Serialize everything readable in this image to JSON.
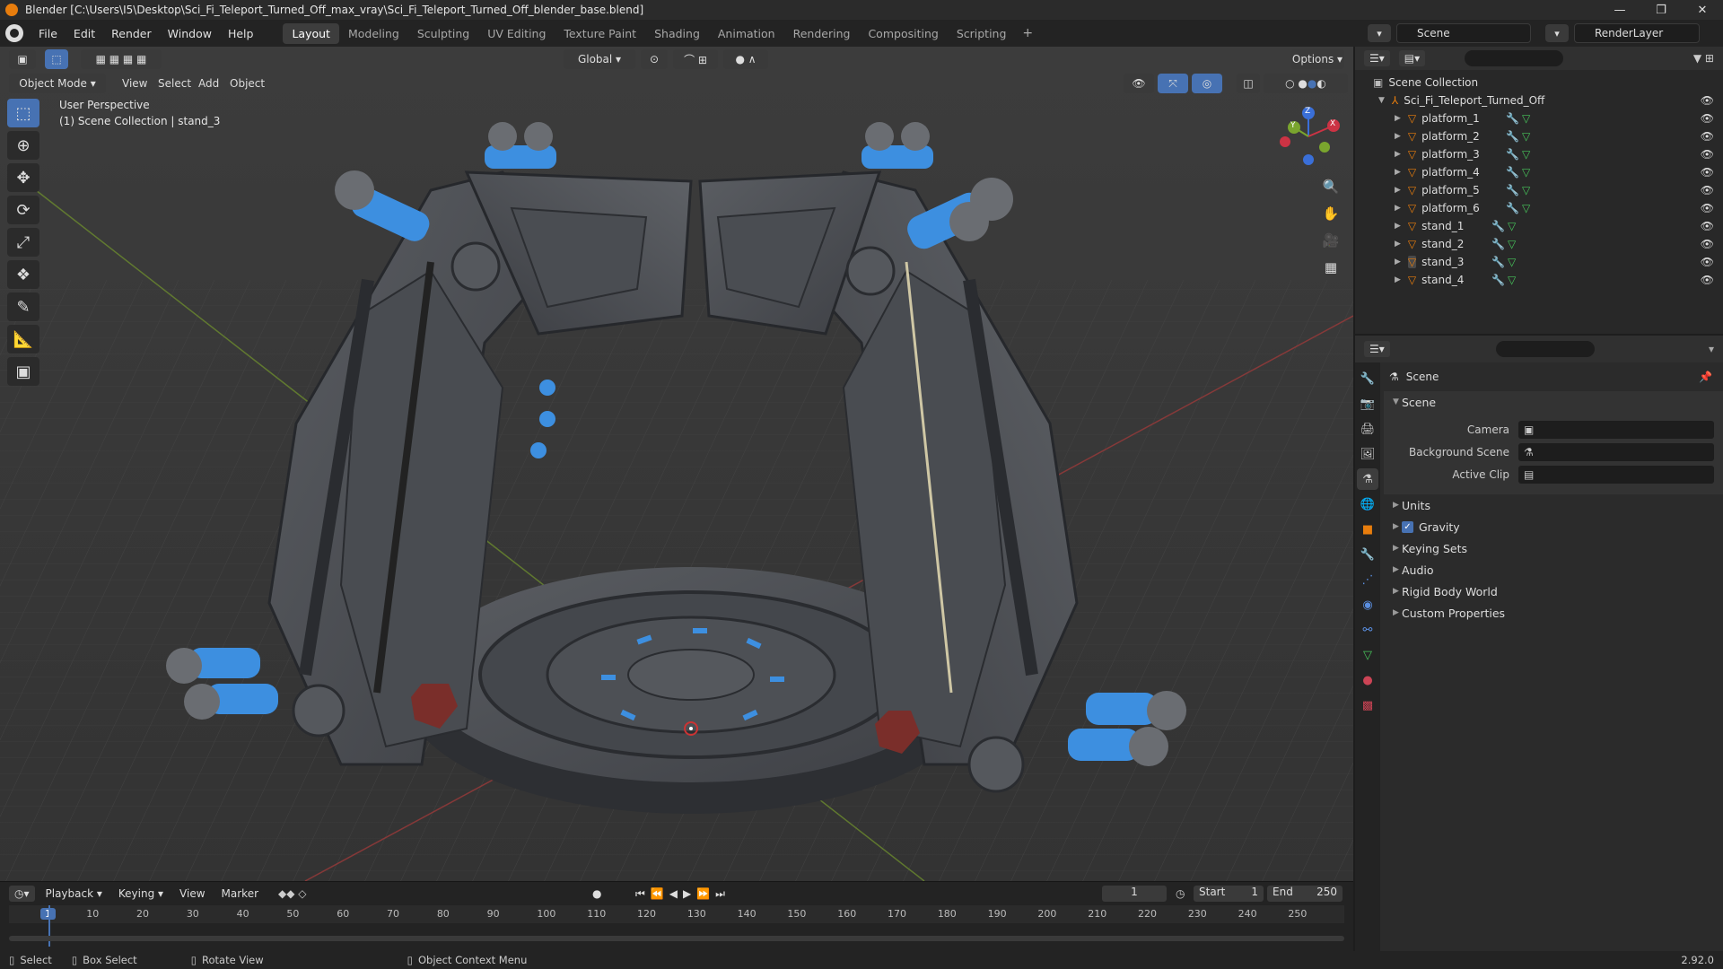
{
  "window": {
    "title": "Blender [C:\\Users\\I5\\Desktop\\Sci_Fi_Teleport_Turned_Off_max_vray\\Sci_Fi_Teleport_Turned_Off_blender_base.blend]",
    "minimize": "—",
    "maximize": "❐",
    "close": "✕"
  },
  "menu": {
    "items": [
      "File",
      "Edit",
      "Render",
      "Window",
      "Help"
    ]
  },
  "workspaces": {
    "tabs": [
      "Layout",
      "Modeling",
      "Sculpting",
      "UV Editing",
      "Texture Paint",
      "Shading",
      "Animation",
      "Rendering",
      "Compositing",
      "Scripting"
    ],
    "active": "Layout"
  },
  "scene": {
    "name": "Scene",
    "view_layer": "RenderLayer"
  },
  "viewport_header": {
    "mode": "Object Mode",
    "menus": [
      "View",
      "Select",
      "Add",
      "Object"
    ],
    "orientation": "Global",
    "options": "Options"
  },
  "viewport": {
    "perspective": "User Perspective",
    "context": "(1) Scene Collection | stand_3",
    "gizmo": {
      "x": "X",
      "y": "Y",
      "z": "Z"
    }
  },
  "outliner": {
    "root": "Scene Collection",
    "collection": "Sci_Fi_Teleport_Turned_Off",
    "objects": [
      "platform_1",
      "platform_2",
      "platform_3",
      "platform_4",
      "platform_5",
      "platform_6",
      "stand_1",
      "stand_2",
      "stand_3",
      "stand_4"
    ]
  },
  "properties": {
    "context": "Scene",
    "panel_title": "Scene",
    "fields": [
      {
        "label": "Camera",
        "value": ""
      },
      {
        "label": "Background Scene",
        "value": ""
      },
      {
        "label": "Active Clip",
        "value": ""
      }
    ],
    "sections": [
      "Units",
      "Gravity",
      "Keying Sets",
      "Audio",
      "Rigid Body World",
      "Custom Properties"
    ],
    "gravity_checked": true
  },
  "timeline": {
    "menus": [
      "Playback",
      "Keying",
      "View",
      "Marker"
    ],
    "current_frame": "1",
    "start_label": "Start",
    "start": "1",
    "end_label": "End",
    "end": "250",
    "ticks": [
      "1",
      "10",
      "20",
      "30",
      "40",
      "50",
      "60",
      "70",
      "80",
      "90",
      "100",
      "110",
      "120",
      "130",
      "140",
      "150",
      "160",
      "170",
      "180",
      "190",
      "200",
      "210",
      "220",
      "230",
      "240",
      "250"
    ]
  },
  "statusbar": {
    "select": "Select",
    "box_select": "Box Select",
    "rotate": "Rotate View",
    "context_menu": "Object Context Menu",
    "version": "2.92.0"
  },
  "colors": {
    "accent": "#4772b3",
    "orange": "#e87d0d",
    "blue_glow": "#3d8fe0"
  }
}
